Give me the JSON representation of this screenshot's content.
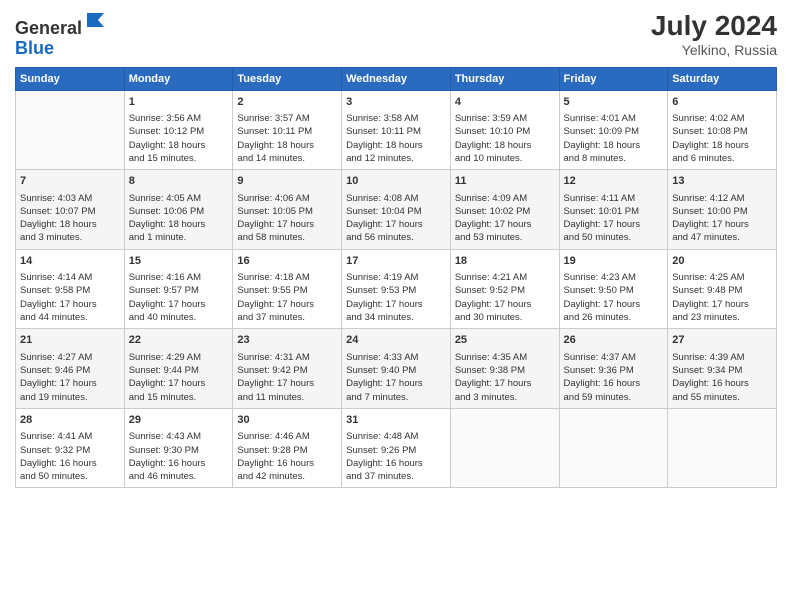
{
  "header": {
    "logo_general": "General",
    "logo_blue": "Blue",
    "month_year": "July 2024",
    "location": "Yelkino, Russia"
  },
  "days_of_week": [
    "Sunday",
    "Monday",
    "Tuesday",
    "Wednesday",
    "Thursday",
    "Friday",
    "Saturday"
  ],
  "weeks": [
    [
      {
        "day": "",
        "data": ""
      },
      {
        "day": "1",
        "data": "Sunrise: 3:56 AM\nSunset: 10:12 PM\nDaylight: 18 hours\nand 15 minutes."
      },
      {
        "day": "2",
        "data": "Sunrise: 3:57 AM\nSunset: 10:11 PM\nDaylight: 18 hours\nand 14 minutes."
      },
      {
        "day": "3",
        "data": "Sunrise: 3:58 AM\nSunset: 10:11 PM\nDaylight: 18 hours\nand 12 minutes."
      },
      {
        "day": "4",
        "data": "Sunrise: 3:59 AM\nSunset: 10:10 PM\nDaylight: 18 hours\nand 10 minutes."
      },
      {
        "day": "5",
        "data": "Sunrise: 4:01 AM\nSunset: 10:09 PM\nDaylight: 18 hours\nand 8 minutes."
      },
      {
        "day": "6",
        "data": "Sunrise: 4:02 AM\nSunset: 10:08 PM\nDaylight: 18 hours\nand 6 minutes."
      }
    ],
    [
      {
        "day": "7",
        "data": "Sunrise: 4:03 AM\nSunset: 10:07 PM\nDaylight: 18 hours\nand 3 minutes."
      },
      {
        "day": "8",
        "data": "Sunrise: 4:05 AM\nSunset: 10:06 PM\nDaylight: 18 hours\nand 1 minute."
      },
      {
        "day": "9",
        "data": "Sunrise: 4:06 AM\nSunset: 10:05 PM\nDaylight: 17 hours\nand 58 minutes."
      },
      {
        "day": "10",
        "data": "Sunrise: 4:08 AM\nSunset: 10:04 PM\nDaylight: 17 hours\nand 56 minutes."
      },
      {
        "day": "11",
        "data": "Sunrise: 4:09 AM\nSunset: 10:02 PM\nDaylight: 17 hours\nand 53 minutes."
      },
      {
        "day": "12",
        "data": "Sunrise: 4:11 AM\nSunset: 10:01 PM\nDaylight: 17 hours\nand 50 minutes."
      },
      {
        "day": "13",
        "data": "Sunrise: 4:12 AM\nSunset: 10:00 PM\nDaylight: 17 hours\nand 47 minutes."
      }
    ],
    [
      {
        "day": "14",
        "data": "Sunrise: 4:14 AM\nSunset: 9:58 PM\nDaylight: 17 hours\nand 44 minutes."
      },
      {
        "day": "15",
        "data": "Sunrise: 4:16 AM\nSunset: 9:57 PM\nDaylight: 17 hours\nand 40 minutes."
      },
      {
        "day": "16",
        "data": "Sunrise: 4:18 AM\nSunset: 9:55 PM\nDaylight: 17 hours\nand 37 minutes."
      },
      {
        "day": "17",
        "data": "Sunrise: 4:19 AM\nSunset: 9:53 PM\nDaylight: 17 hours\nand 34 minutes."
      },
      {
        "day": "18",
        "data": "Sunrise: 4:21 AM\nSunset: 9:52 PM\nDaylight: 17 hours\nand 30 minutes."
      },
      {
        "day": "19",
        "data": "Sunrise: 4:23 AM\nSunset: 9:50 PM\nDaylight: 17 hours\nand 26 minutes."
      },
      {
        "day": "20",
        "data": "Sunrise: 4:25 AM\nSunset: 9:48 PM\nDaylight: 17 hours\nand 23 minutes."
      }
    ],
    [
      {
        "day": "21",
        "data": "Sunrise: 4:27 AM\nSunset: 9:46 PM\nDaylight: 17 hours\nand 19 minutes."
      },
      {
        "day": "22",
        "data": "Sunrise: 4:29 AM\nSunset: 9:44 PM\nDaylight: 17 hours\nand 15 minutes."
      },
      {
        "day": "23",
        "data": "Sunrise: 4:31 AM\nSunset: 9:42 PM\nDaylight: 17 hours\nand 11 minutes."
      },
      {
        "day": "24",
        "data": "Sunrise: 4:33 AM\nSunset: 9:40 PM\nDaylight: 17 hours\nand 7 minutes."
      },
      {
        "day": "25",
        "data": "Sunrise: 4:35 AM\nSunset: 9:38 PM\nDaylight: 17 hours\nand 3 minutes."
      },
      {
        "day": "26",
        "data": "Sunrise: 4:37 AM\nSunset: 9:36 PM\nDaylight: 16 hours\nand 59 minutes."
      },
      {
        "day": "27",
        "data": "Sunrise: 4:39 AM\nSunset: 9:34 PM\nDaylight: 16 hours\nand 55 minutes."
      }
    ],
    [
      {
        "day": "28",
        "data": "Sunrise: 4:41 AM\nSunset: 9:32 PM\nDaylight: 16 hours\nand 50 minutes."
      },
      {
        "day": "29",
        "data": "Sunrise: 4:43 AM\nSunset: 9:30 PM\nDaylight: 16 hours\nand 46 minutes."
      },
      {
        "day": "30",
        "data": "Sunrise: 4:46 AM\nSunset: 9:28 PM\nDaylight: 16 hours\nand 42 minutes."
      },
      {
        "day": "31",
        "data": "Sunrise: 4:48 AM\nSunset: 9:26 PM\nDaylight: 16 hours\nand 37 minutes."
      },
      {
        "day": "",
        "data": ""
      },
      {
        "day": "",
        "data": ""
      },
      {
        "day": "",
        "data": ""
      }
    ]
  ]
}
